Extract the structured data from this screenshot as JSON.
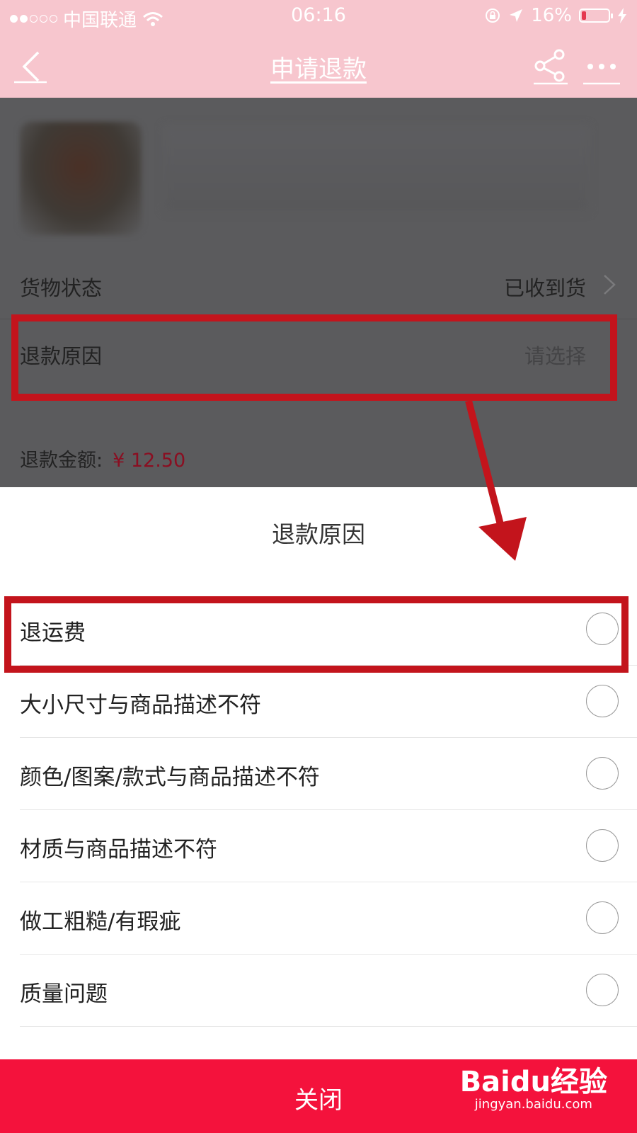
{
  "status_bar": {
    "carrier": "中国联通",
    "time": "06:16",
    "battery_percent": "16%",
    "battery_level": 0.16,
    "signal_dots_filled": 2,
    "signal_dots_total": 5
  },
  "nav": {
    "title": "申请退款"
  },
  "page": {
    "goods_status_label": "货物状态",
    "goods_status_value": "已收到货",
    "refund_reason_label": "退款原因",
    "refund_reason_placeholder": "请选择",
    "refund_amount_label": "退款金额:",
    "refund_amount_value": "¥ 12.50"
  },
  "sheet": {
    "title": "退款原因",
    "options": [
      {
        "label": "退运费",
        "selected": false
      },
      {
        "label": "大小尺寸与商品描述不符",
        "selected": false
      },
      {
        "label": "颜色/图案/款式与商品描述不符",
        "selected": false
      },
      {
        "label": "材质与商品描述不符",
        "selected": false
      },
      {
        "label": "做工粗糙/有瑕疵",
        "selected": false
      },
      {
        "label": "质量问题",
        "selected": false
      }
    ],
    "close_label": "关闭"
  },
  "watermark": {
    "logo_text": "Baidu经验",
    "url": "jingyan.baidu.com"
  },
  "colors": {
    "header_pink": "#f7c6ce",
    "overlay_dark": "#5b5b5d",
    "price_red": "#8a0f22",
    "close_red": "#f4123c",
    "annotation_red": "#c3141c"
  }
}
